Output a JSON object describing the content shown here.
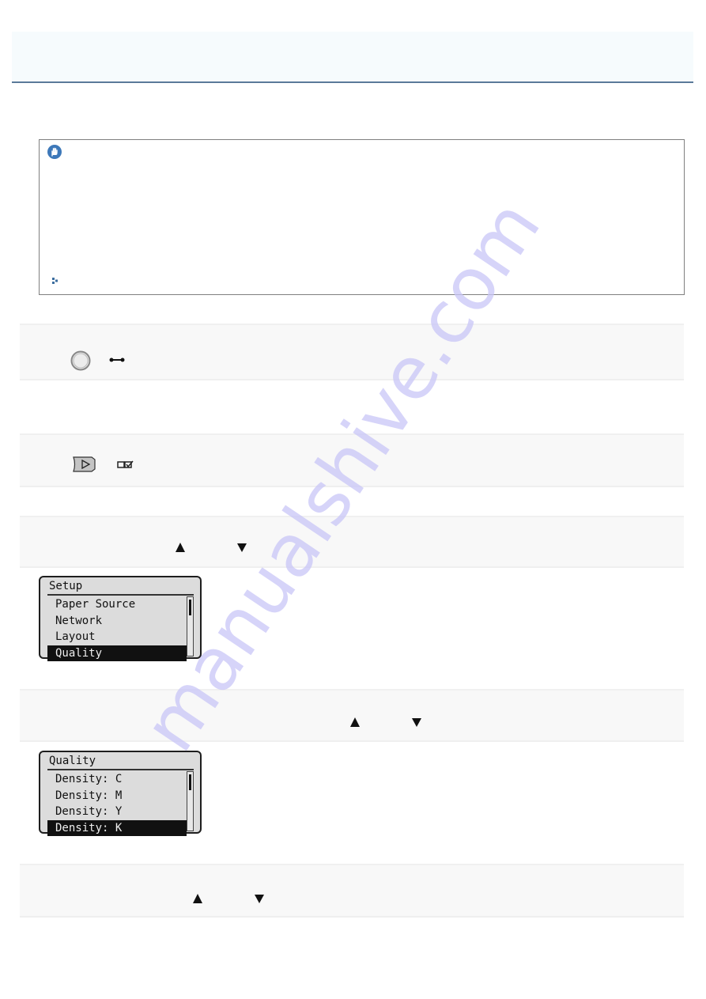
{
  "header": {
    "title": ""
  },
  "note": {
    "icon": "hand-stop-icon",
    "link_icon": "link-arrow-icon"
  },
  "steps": [
    {
      "icons": [
        "circle-button-icon",
        "online-key-icon"
      ]
    },
    {
      "icons": [
        "menu-right-button-icon",
        "menu-setup-icon"
      ]
    },
    {
      "icons": [
        "up-arrow-icon",
        "down-arrow-icon"
      ]
    },
    {
      "icons": [
        "up-arrow-icon",
        "down-arrow-icon"
      ]
    },
    {
      "icons": [
        "up-arrow-icon",
        "down-arrow-icon"
      ]
    }
  ],
  "lcd_setup": {
    "title": "Setup",
    "items": [
      "Paper Source",
      "Network",
      "Layout",
      "Quality"
    ],
    "selected_index": 3
  },
  "lcd_quality": {
    "title": "Quality",
    "items": [
      "Density: C",
      "Density: M",
      "Density: Y",
      "Density: K"
    ],
    "selected_index": 3
  },
  "watermark": {
    "text": "manualshive.com",
    "color": "#c9c6f7"
  },
  "colors": {
    "accent": "#3d78b9",
    "header_rule": "#5b7a99",
    "step_bg": "#f8f8f8"
  }
}
